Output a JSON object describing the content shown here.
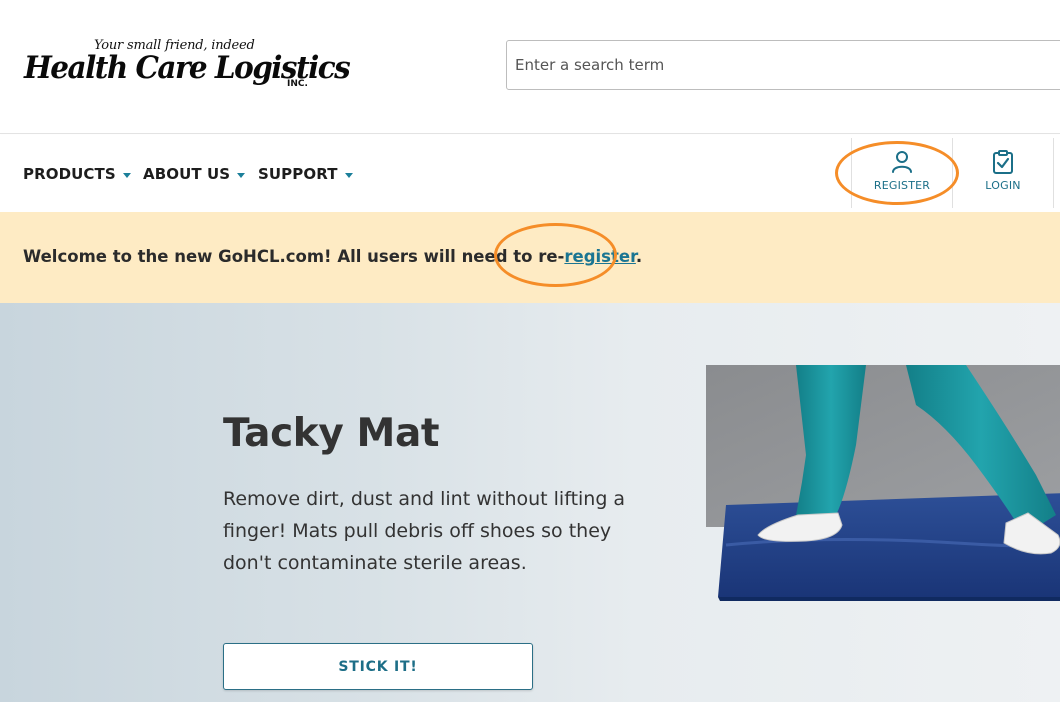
{
  "logo": {
    "tagline": "Your small friend, indeed",
    "name": "Health Care Logistics",
    "suffix": "INC."
  },
  "search": {
    "placeholder": "Enter a search term",
    "value": ""
  },
  "nav": {
    "items": [
      {
        "label": "PRODUCTS"
      },
      {
        "label": "ABOUT US"
      },
      {
        "label": "SUPPORT"
      }
    ]
  },
  "account": {
    "register_label": "REGISTER",
    "login_label": "LOGIN"
  },
  "banner": {
    "text_before": "Welcome to the new GoHCL.com! All users will need to re-",
    "link_text": "register",
    "text_after": "."
  },
  "hero": {
    "title": "Tacky Mat",
    "description": "Remove dirt, dust and lint without lifting a finger! Mats pull debris off shoes so they don't contaminate sterile areas.",
    "button_label": "STICK IT!"
  },
  "colors": {
    "accent": "#1b7592",
    "banner_bg": "#feebc4",
    "annotation": "#f58d28",
    "scrubs": "#1f9aa3",
    "mat": "#1c3f86"
  },
  "icons": {
    "register": "user-icon",
    "login": "clipboard-check-icon",
    "nav_caret": "caret-down-icon"
  }
}
